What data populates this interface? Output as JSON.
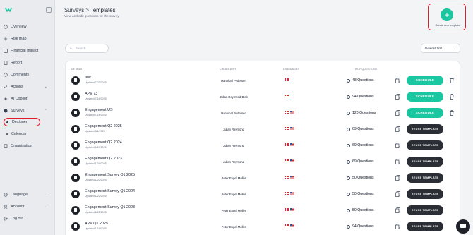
{
  "sidebar": {
    "items": [
      {
        "label": "Overview",
        "icon": "overview-icon"
      },
      {
        "label": "Risk map",
        "icon": "map-icon"
      },
      {
        "label": "Financial Impact",
        "icon": "chart-icon"
      },
      {
        "label": "Report",
        "icon": "report-icon"
      },
      {
        "label": "Comments",
        "icon": "comment-icon"
      },
      {
        "label": "Actions",
        "icon": "actions-icon"
      },
      {
        "label": "AI Copilot",
        "icon": "copilot-icon"
      },
      {
        "label": "Surveys",
        "icon": "surveys-icon"
      },
      {
        "label": "Designer"
      },
      {
        "label": "Calendar"
      },
      {
        "label": "Organisation",
        "icon": "building-icon"
      }
    ],
    "bottom": [
      {
        "label": "Language",
        "icon": "globe-icon"
      },
      {
        "label": "Account",
        "icon": "user-icon"
      },
      {
        "label": "Log out",
        "icon": "logout-icon"
      }
    ]
  },
  "header": {
    "breadcrumb_parent": "Surveys",
    "breadcrumb_sep": ">",
    "breadcrumb_current": "Templates",
    "subtitle": "View and edit questions for the survey",
    "create_label": "Create new template",
    "create_icon": "+"
  },
  "toolbar": {
    "search_placeholder": "Search...",
    "sort_value": "Newest first"
  },
  "table": {
    "headers": {
      "details": "DETAILS",
      "created_by": "CREATED BY",
      "languages": "LANGUAGES",
      "questions": "# OF QUESTIONS"
    },
    "rows": [
      {
        "name": "test",
        "updated": "Updated 7/23/2025",
        "creator": "Hannibal Pedersen",
        "flags": [
          "dk"
        ],
        "questions": "48 Questions",
        "action": "SCHEDULE",
        "trash": true
      },
      {
        "name": "APV 73",
        "updated": "Updated 7/16/2025",
        "creator": "Julian Raymond Blok",
        "flags": [
          "dk"
        ],
        "questions": "94 Questions",
        "action": "SCHEDULE",
        "trash": true
      },
      {
        "name": "Engagement US",
        "updated": "Updated 7/16/2025",
        "creator": "Hannibal Pedersen",
        "flags": [
          "dk",
          "us"
        ],
        "questions": "120 Questions",
        "action": "SCHEDULE",
        "trash": true
      },
      {
        "name": "Engagement Q2 2025",
        "updated": "Updated 6/1/2025",
        "creator": "Julian Raymond",
        "flags": [
          "dk",
          "us"
        ],
        "questions": "69 Questions",
        "action": "REUSE TEMPLATE",
        "trash": false
      },
      {
        "name": "Engagement Q2 2024",
        "updated": "Updated 1/24/2025",
        "creator": "Julian Raymond",
        "flags": [
          "dk",
          "us"
        ],
        "questions": "69 Questions",
        "action": "REUSE TEMPLATE",
        "trash": false
      },
      {
        "name": "Engagement Q2 2023",
        "updated": "Updated 1/24/2025",
        "creator": "Julian Raymond",
        "flags": [
          "dk",
          "us"
        ],
        "questions": "69 Questions",
        "action": "REUSE TEMPLATE",
        "trash": false
      },
      {
        "name": "Engagement Survey Q1 2025",
        "updated": "Updated 1/22/2025",
        "creator": "Peter Engel Møller",
        "flags": [
          "dk",
          "us"
        ],
        "questions": "50 Questions",
        "action": "REUSE TEMPLATE",
        "trash": false
      },
      {
        "name": "Engagement Survey Q1 2024",
        "updated": "Updated 1/22/2025",
        "creator": "Peter Engel Møller",
        "flags": [
          "dk",
          "us"
        ],
        "questions": "50 Questions",
        "action": "REUSE TEMPLATE",
        "trash": false
      },
      {
        "name": "Engagement Survey Q1 2023",
        "updated": "Updated 1/22/2025",
        "creator": "Peter Engel Møller",
        "flags": [
          "dk",
          "us"
        ],
        "questions": "50 Questions",
        "action": "REUSE TEMPLATE",
        "trash": false
      },
      {
        "name": "APV Q1 2025",
        "updated": "Updated 1/16/2025",
        "creator": "Peter Engel Møller",
        "flags": [
          "dk",
          "us"
        ],
        "questions": "94 Questions",
        "action": "REUSE TEMPLATE",
        "trash": false
      }
    ]
  },
  "colors": {
    "accent": "#1bc7a1",
    "dark_button": "#2b2f35",
    "highlight": "#e11d2a"
  }
}
